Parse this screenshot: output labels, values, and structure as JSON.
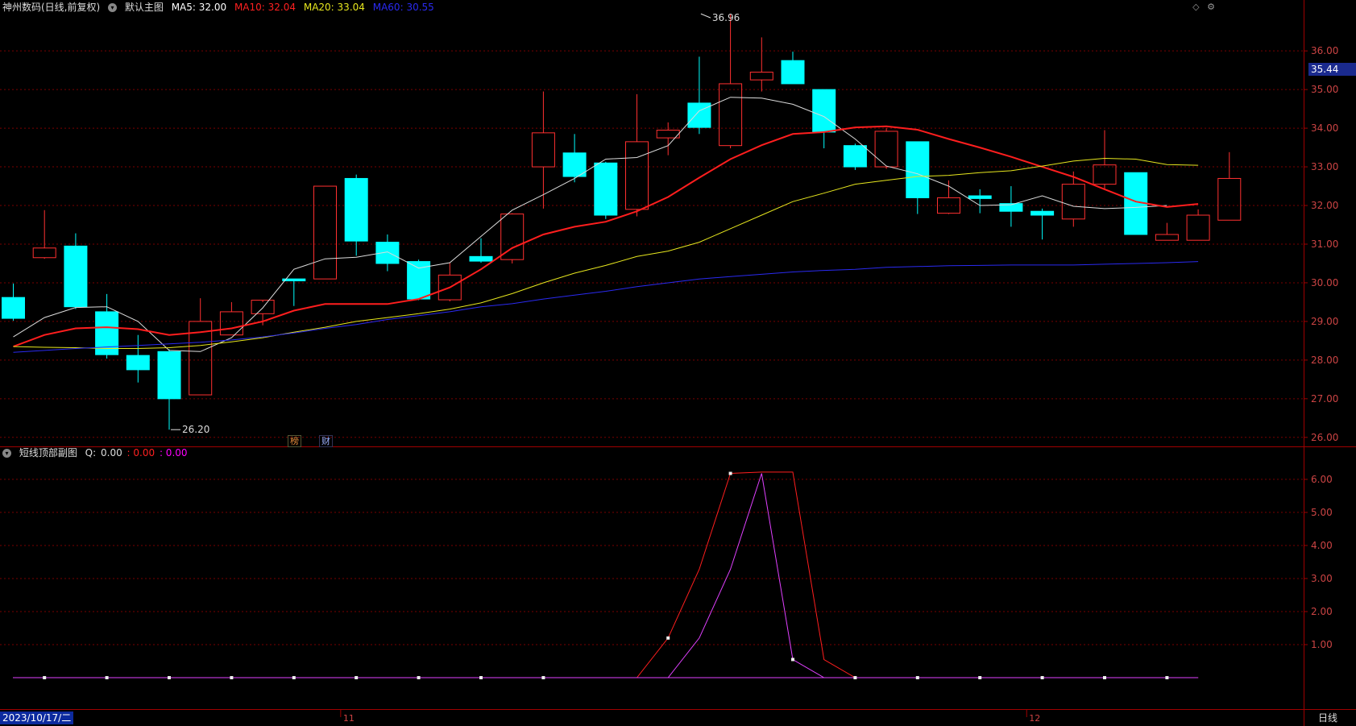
{
  "header": {
    "stock_title": "神州数码(日线,前复权)",
    "main_view_label": "默认主图",
    "ma": [
      {
        "label": "MA5:",
        "value": "32.00",
        "color": "#ffffff"
      },
      {
        "label": "MA10:",
        "value": "32.04",
        "color": "#ff2020"
      },
      {
        "label": "MA20:",
        "value": "33.04",
        "color": "#e6e61e"
      },
      {
        "label": "MA60:",
        "value": "30.55",
        "color": "#2a2af0"
      }
    ]
  },
  "sub_header": {
    "indicator_title": "短线顶部副图",
    "q_label": "Q:",
    "q_value": "0.00",
    "v2": ": 0.00",
    "v3": ": 0.00",
    "v2_color": "#ff2020",
    "v3_color": "#ff00ff"
  },
  "badges": {
    "b1": "榜",
    "b2": "财"
  },
  "current_price": "35.44",
  "footer": {
    "date": "2023/10/17/二",
    "period": "日线"
  },
  "colors": {
    "up": "#ff3030",
    "down": "#00ffff",
    "grid": "#7a0000",
    "axis": "#a00000"
  },
  "chart_data": [
    {
      "type": "candlestick",
      "title": "",
      "y_ticks": [
        "26.00",
        "27.00",
        "28.00",
        "29.00",
        "30.00",
        "31.00",
        "32.00",
        "33.00",
        "34.00",
        "35.00",
        "36.00"
      ],
      "ylim": [
        25.85,
        36.9
      ],
      "x_tick_labels": [
        {
          "index": 11,
          "label": "11"
        },
        {
          "index": 33,
          "label": "12"
        }
      ],
      "annotations": [
        {
          "index": 22,
          "price": 36.96,
          "label": "36.96"
        },
        {
          "index": 5,
          "price": 26.2,
          "label": "26.20"
        }
      ],
      "candles": [
        {
          "o": 29.62,
          "h": 29.98,
          "l": 29.02,
          "c": 29.08
        },
        {
          "o": 30.65,
          "h": 31.88,
          "l": 30.62,
          "c": 30.9
        },
        {
          "o": 30.95,
          "h": 31.28,
          "l": 29.32,
          "c": 29.38
        },
        {
          "o": 29.25,
          "h": 29.71,
          "l": 28.04,
          "c": 28.14
        },
        {
          "o": 28.12,
          "h": 28.65,
          "l": 27.42,
          "c": 27.75
        },
        {
          "o": 28.22,
          "h": 28.28,
          "l": 26.2,
          "c": 27.0
        },
        {
          "o": 27.1,
          "h": 29.6,
          "l": 27.1,
          "c": 29.0
        },
        {
          "o": 28.65,
          "h": 29.5,
          "l": 28.65,
          "c": 29.25
        },
        {
          "o": 29.2,
          "h": 29.5,
          "l": 28.9,
          "c": 29.55
        },
        {
          "o": 30.1,
          "h": 30.1,
          "l": 29.4,
          "c": 30.05
        },
        {
          "o": 30.1,
          "h": 32.5,
          "l": 30.1,
          "c": 32.5
        },
        {
          "o": 32.7,
          "h": 32.8,
          "l": 30.7,
          "c": 31.08
        },
        {
          "o": 31.05,
          "h": 31.25,
          "l": 30.3,
          "c": 30.5
        },
        {
          "o": 30.55,
          "h": 30.6,
          "l": 29.55,
          "c": 29.58
        },
        {
          "o": 29.56,
          "h": 30.52,
          "l": 29.52,
          "c": 30.2
        },
        {
          "o": 30.68,
          "h": 31.15,
          "l": 30.52,
          "c": 30.56
        },
        {
          "o": 30.6,
          "h": 31.8,
          "l": 30.5,
          "c": 31.78
        },
        {
          "o": 33.0,
          "h": 34.95,
          "l": 31.92,
          "c": 33.88
        },
        {
          "o": 33.36,
          "h": 33.85,
          "l": 32.6,
          "c": 32.75
        },
        {
          "o": 33.1,
          "h": 33.13,
          "l": 31.65,
          "c": 31.75
        },
        {
          "o": 31.9,
          "h": 34.88,
          "l": 31.72,
          "c": 33.65
        },
        {
          "o": 33.75,
          "h": 34.15,
          "l": 33.3,
          "c": 33.95
        },
        {
          "o": 34.65,
          "h": 35.85,
          "l": 33.85,
          "c": 34.02
        },
        {
          "o": 33.55,
          "h": 36.96,
          "l": 33.48,
          "c": 35.15
        },
        {
          "o": 35.25,
          "h": 36.35,
          "l": 34.95,
          "c": 35.45
        },
        {
          "o": 35.75,
          "h": 35.98,
          "l": 35.15,
          "c": 35.15
        },
        {
          "o": 35.0,
          "h": 35.0,
          "l": 33.48,
          "c": 33.9
        },
        {
          "o": 33.55,
          "h": 33.6,
          "l": 32.92,
          "c": 33.0
        },
        {
          "o": 33.0,
          "h": 34.0,
          "l": 32.95,
          "c": 33.92
        },
        {
          "o": 33.65,
          "h": 33.65,
          "l": 31.78,
          "c": 32.2
        },
        {
          "o": 31.8,
          "h": 32.65,
          "l": 31.78,
          "c": 32.2
        },
        {
          "o": 32.25,
          "h": 32.42,
          "l": 31.8,
          "c": 32.18
        },
        {
          "o": 32.05,
          "h": 32.5,
          "l": 31.45,
          "c": 31.85
        },
        {
          "o": 31.85,
          "h": 31.92,
          "l": 31.12,
          "c": 31.75
        },
        {
          "o": 31.65,
          "h": 32.88,
          "l": 31.45,
          "c": 32.55
        },
        {
          "o": 32.55,
          "h": 33.95,
          "l": 32.4,
          "c": 33.05
        },
        {
          "o": 32.85,
          "h": 32.85,
          "l": 31.25,
          "c": 31.25
        },
        {
          "o": 31.1,
          "h": 31.55,
          "l": 31.1,
          "c": 31.25
        },
        {
          "o": 31.1,
          "h": 31.9,
          "l": 31.1,
          "c": 31.75
        },
        {
          "o": 31.62,
          "h": 33.38,
          "l": 31.62,
          "c": 32.7
        }
      ],
      "series": [
        {
          "name": "MA5",
          "color": "#dcdcdc",
          "width": 1,
          "values": [
            28.6,
            29.1,
            29.36,
            29.38,
            29.0,
            28.25,
            28.22,
            28.58,
            29.35,
            30.35,
            30.62,
            30.66,
            30.8,
            30.38,
            30.52,
            31.2,
            31.88,
            32.28,
            32.7,
            33.2,
            33.24,
            33.55,
            34.45,
            34.8,
            34.78,
            34.62,
            34.3,
            33.72,
            33.02,
            32.82,
            32.5,
            32.0,
            32.02,
            32.25,
            31.98,
            31.92,
            31.95,
            32.0
          ]
        },
        {
          "name": "MA10",
          "color": "#ff1e1e",
          "width": 2,
          "values": [
            28.35,
            28.65,
            28.82,
            28.85,
            28.8,
            28.65,
            28.72,
            28.82,
            29.0,
            29.28,
            29.45,
            29.45,
            29.45,
            29.58,
            29.88,
            30.35,
            30.9,
            31.25,
            31.45,
            31.58,
            31.85,
            32.22,
            32.72,
            33.2,
            33.56,
            33.85,
            33.9,
            34.02,
            34.05,
            33.96,
            33.72,
            33.5,
            33.26,
            33.0,
            32.74,
            32.42,
            32.1,
            31.96,
            32.04
          ]
        },
        {
          "name": "MA20",
          "color": "#e6e61e",
          "width": 1,
          "values": [
            28.35,
            28.33,
            28.32,
            28.3,
            28.3,
            28.32,
            28.38,
            28.47,
            28.58,
            28.72,
            28.85,
            29.0,
            29.1,
            29.2,
            29.32,
            29.48,
            29.72,
            30.0,
            30.25,
            30.45,
            30.68,
            30.82,
            31.05,
            31.4,
            31.75,
            32.1,
            32.32,
            32.55,
            32.65,
            32.75,
            32.78,
            32.85,
            32.9,
            33.02,
            33.15,
            33.22,
            33.2,
            33.06,
            33.04
          ]
        },
        {
          "name": "MA60",
          "color": "#2a2af0",
          "width": 1,
          "values": [
            28.2,
            28.25,
            28.3,
            28.34,
            28.38,
            28.42,
            28.46,
            28.52,
            28.6,
            28.7,
            28.82,
            28.92,
            29.05,
            29.15,
            29.25,
            29.38,
            29.46,
            29.58,
            29.68,
            29.78,
            29.9,
            30.0,
            30.1,
            30.16,
            30.22,
            30.28,
            30.32,
            30.35,
            30.4,
            30.42,
            30.44,
            30.45,
            30.46,
            30.46,
            30.46,
            30.48,
            30.5,
            30.52,
            30.55
          ]
        }
      ]
    },
    {
      "type": "line",
      "title": "",
      "y_ticks": [
        "1.00",
        "2.00",
        "3.00",
        "4.00",
        "5.00",
        "6.00"
      ],
      "ylim": [
        -0.95,
        6.9
      ],
      "series": [
        {
          "name": "",
          "color": "#ff1e1e",
          "width": 1,
          "values": [
            0,
            0,
            0,
            0,
            0,
            0,
            0,
            0,
            0,
            0,
            0,
            0,
            0,
            0,
            0,
            0,
            0,
            0,
            0,
            0,
            0,
            1.2,
            3.28,
            6.18,
            6.22,
            6.22,
            0.55,
            0,
            0,
            0,
            0,
            0,
            0,
            0,
            0,
            0,
            0,
            0,
            0
          ]
        },
        {
          "name": "",
          "color": "#e040ff",
          "width": 1,
          "values": [
            0,
            0,
            0,
            0,
            0,
            0,
            0,
            0,
            0,
            0,
            0,
            0,
            0,
            0,
            0,
            0,
            0,
            0,
            0,
            0,
            0,
            0,
            1.2,
            3.28,
            6.18,
            0.55,
            0,
            0,
            0,
            0,
            0,
            0,
            0,
            0,
            0,
            0,
            0,
            0,
            0
          ]
        }
      ],
      "markers": [
        {
          "index": 1,
          "value": 0
        },
        {
          "index": 3,
          "value": 0
        },
        {
          "index": 5,
          "value": 0
        },
        {
          "index": 7,
          "value": 0
        },
        {
          "index": 9,
          "value": 0
        },
        {
          "index": 11,
          "value": 0
        },
        {
          "index": 13,
          "value": 0
        },
        {
          "index": 15,
          "value": 0
        },
        {
          "index": 17,
          "value": 0
        },
        {
          "index": 21,
          "value": 1.2
        },
        {
          "index": 23,
          "value": 6.18
        },
        {
          "index": 25,
          "value": 0.55
        },
        {
          "index": 27,
          "value": 0
        },
        {
          "index": 29,
          "value": 0
        },
        {
          "index": 31,
          "value": 0
        },
        {
          "index": 33,
          "value": 0
        },
        {
          "index": 35,
          "value": 0
        },
        {
          "index": 37,
          "value": 0
        }
      ]
    }
  ]
}
